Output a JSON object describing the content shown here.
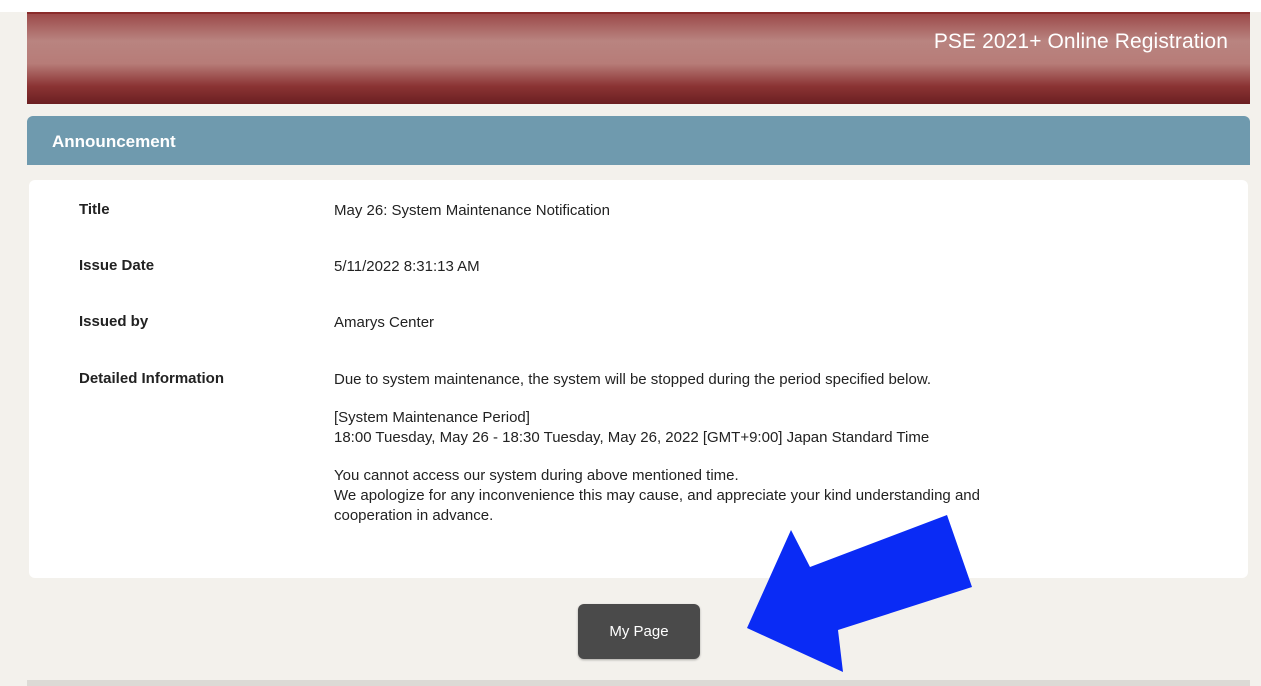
{
  "header": {
    "title": "PSE 2021+ Online Registration"
  },
  "announcement": {
    "section_title": "Announcement",
    "fields": [
      {
        "label": "Title",
        "value": "May 26: System Maintenance Notification"
      },
      {
        "label": "Issue Date",
        "value": "5/11/2022 8:31:13 AM"
      },
      {
        "label": "Issued by",
        "value": "Amarys Center"
      },
      {
        "label": "Detailed Information"
      }
    ],
    "details": {
      "intro": "Due to system maintenance, the system will be stopped during the period specified below.",
      "period_heading": "[System Maintenance Period]",
      "period": "18:00 Tuesday, May 26 - 18:30 Tuesday, May 26, 2022 [GMT+9:00] Japan Standard Time",
      "notice_line1": "You cannot access our system during above mentioned time.",
      "notice_line2": "We apologize for any inconvenience this may cause, and appreciate your kind understanding and",
      "notice_line3": "cooperation in advance."
    }
  },
  "actions": {
    "my_page_label": "My Page"
  },
  "colors": {
    "header": "#8b3434",
    "announce_bar": "#6f9aae",
    "button": "#4a4a4a",
    "arrow": "#0a2bf5"
  },
  "annotation": {
    "icon": "arrow-pointer-icon"
  }
}
